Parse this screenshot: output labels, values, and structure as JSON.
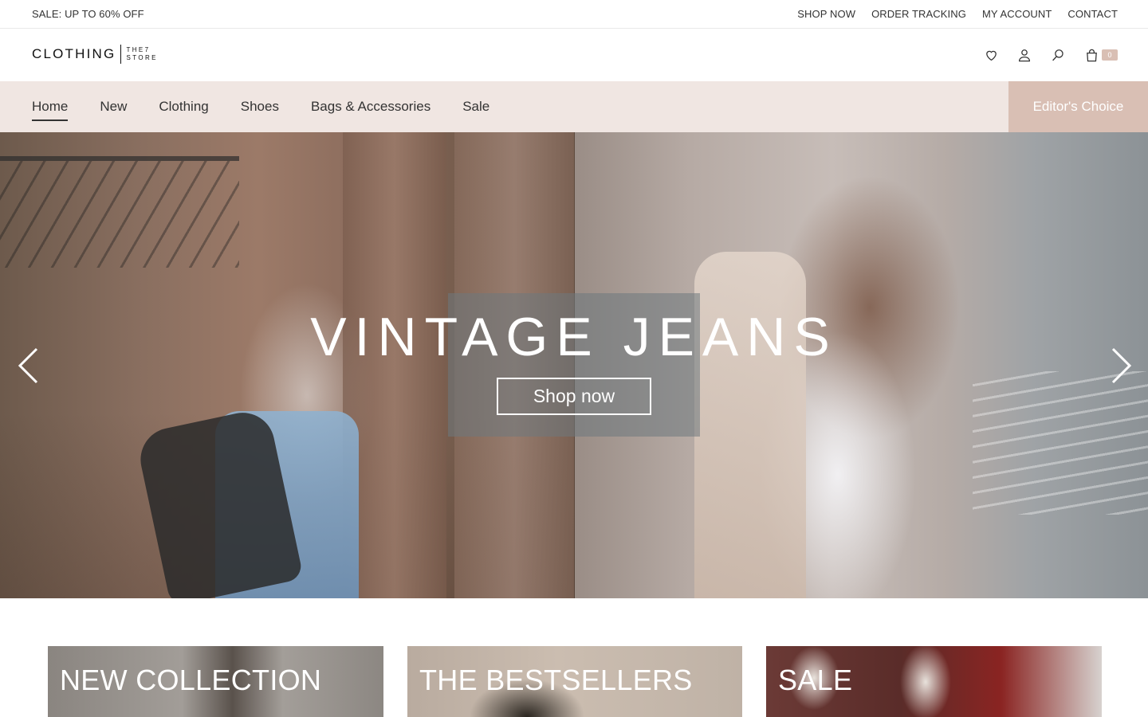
{
  "topbar": {
    "promo": "SALE: UP TO 60% OFF",
    "links": [
      "SHOP NOW",
      "ORDER TRACKING",
      "MY ACCOUNT",
      "CONTACT"
    ]
  },
  "logo": {
    "word": "CLOTHING",
    "sub_line1": "THE7",
    "sub_line2": "STORE"
  },
  "header_icons": [
    "heart-icon",
    "user-icon",
    "search-icon",
    "bag-icon"
  ],
  "cart_count": "0",
  "nav": {
    "items": [
      "Home",
      "New",
      "Clothing",
      "Shoes",
      "Bags & Accessories",
      "Sale"
    ],
    "active": "Home",
    "cta": "Editor's Choice"
  },
  "hero": {
    "title": "VINTAGE JEANS",
    "button": "Shop now"
  },
  "categories": [
    "NEW COLLECTION",
    "THE BESTSELLERS",
    "SALE"
  ],
  "colors": {
    "accent": "#d9bfb4",
    "nav_bg": "#f0e6e2",
    "text": "#333333"
  }
}
